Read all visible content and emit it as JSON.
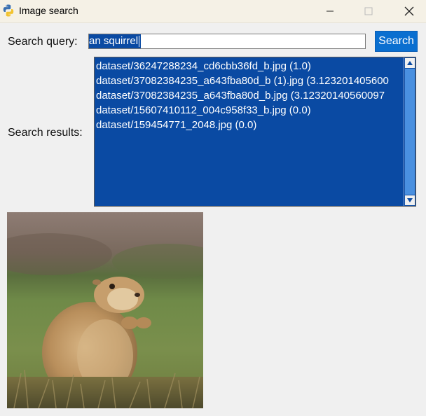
{
  "window": {
    "title": "Image search",
    "icon": "python-icon"
  },
  "search": {
    "label": "Search query:",
    "value": "an squirrel",
    "button_label": "Search"
  },
  "results": {
    "label": "Search results:",
    "items": [
      "dataset/36247288234_cd6cbb36fd_b.jpg (1.0)",
      "dataset/37082384235_a643fba80d_b (1).jpg (3.123201405600",
      "dataset/37082384235_a643fba80d_b.jpg (3.12320140560097",
      "dataset/15607410112_004c958f33_b.jpg (0.0)",
      "dataset/159454771_2048.jpg (0.0)"
    ]
  },
  "colors": {
    "selection": "#0a4aa3",
    "button": "#0a6fd0",
    "titlebar": "#f5f1e6"
  },
  "preview": {
    "subject": "prairie dog standing on grass"
  }
}
